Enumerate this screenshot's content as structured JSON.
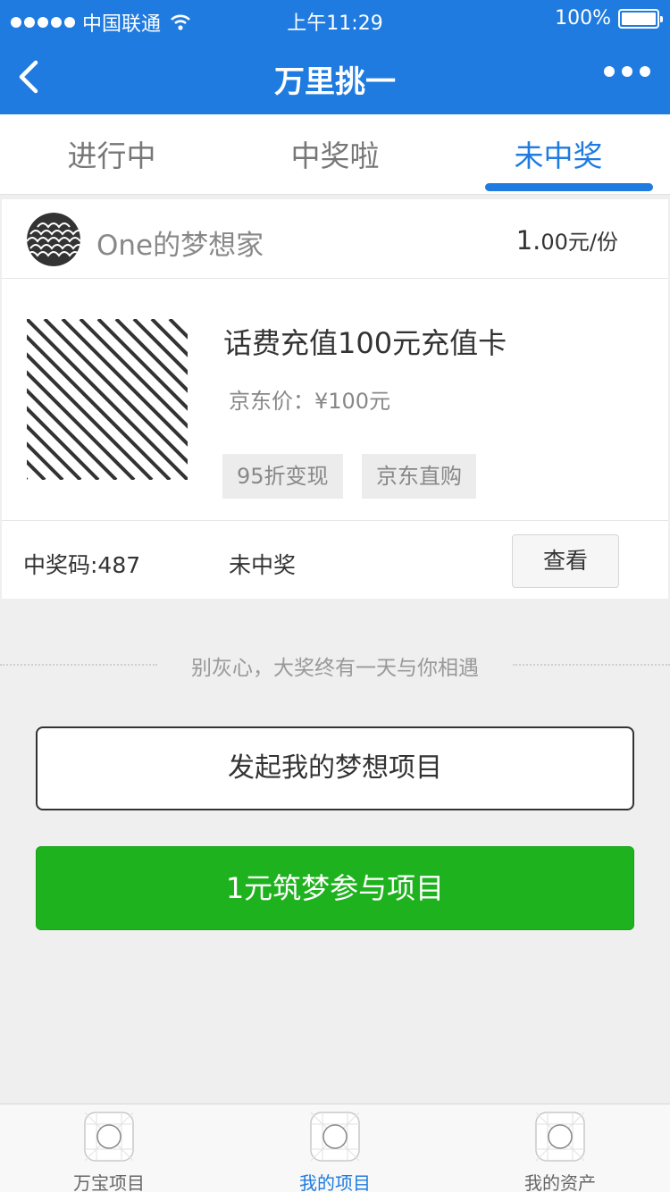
{
  "status_bar": {
    "carrier": "中国联通",
    "time": "上午11:29",
    "battery": "100%"
  },
  "nav": {
    "title": "万里挑一"
  },
  "tabs": [
    {
      "label": "进行中"
    },
    {
      "label": "中奖啦"
    },
    {
      "label": "未中奖"
    }
  ],
  "card": {
    "seller_name": "One的梦想家",
    "price_main": "1.",
    "price_rest": "00元/份",
    "product_title": "话费充值100元充值卡",
    "jd_price": "京东价：¥100元",
    "tags": [
      "95折变现",
      "京东直购"
    ],
    "prize_code": "中奖码:487",
    "status": "未中奖",
    "view_label": "查看"
  },
  "separator_text": "别灰心，大奖终有一天与你相遇",
  "buttons": {
    "launch_label": "发起我的梦想项目",
    "join_label": "1元筑梦参与项目"
  },
  "tabbar": [
    {
      "label": "万宝项目"
    },
    {
      "label": "我的项目"
    },
    {
      "label": "我的资产"
    }
  ],
  "colors": {
    "brand_blue": "#1f7be0",
    "action_green": "#1fb21f"
  }
}
